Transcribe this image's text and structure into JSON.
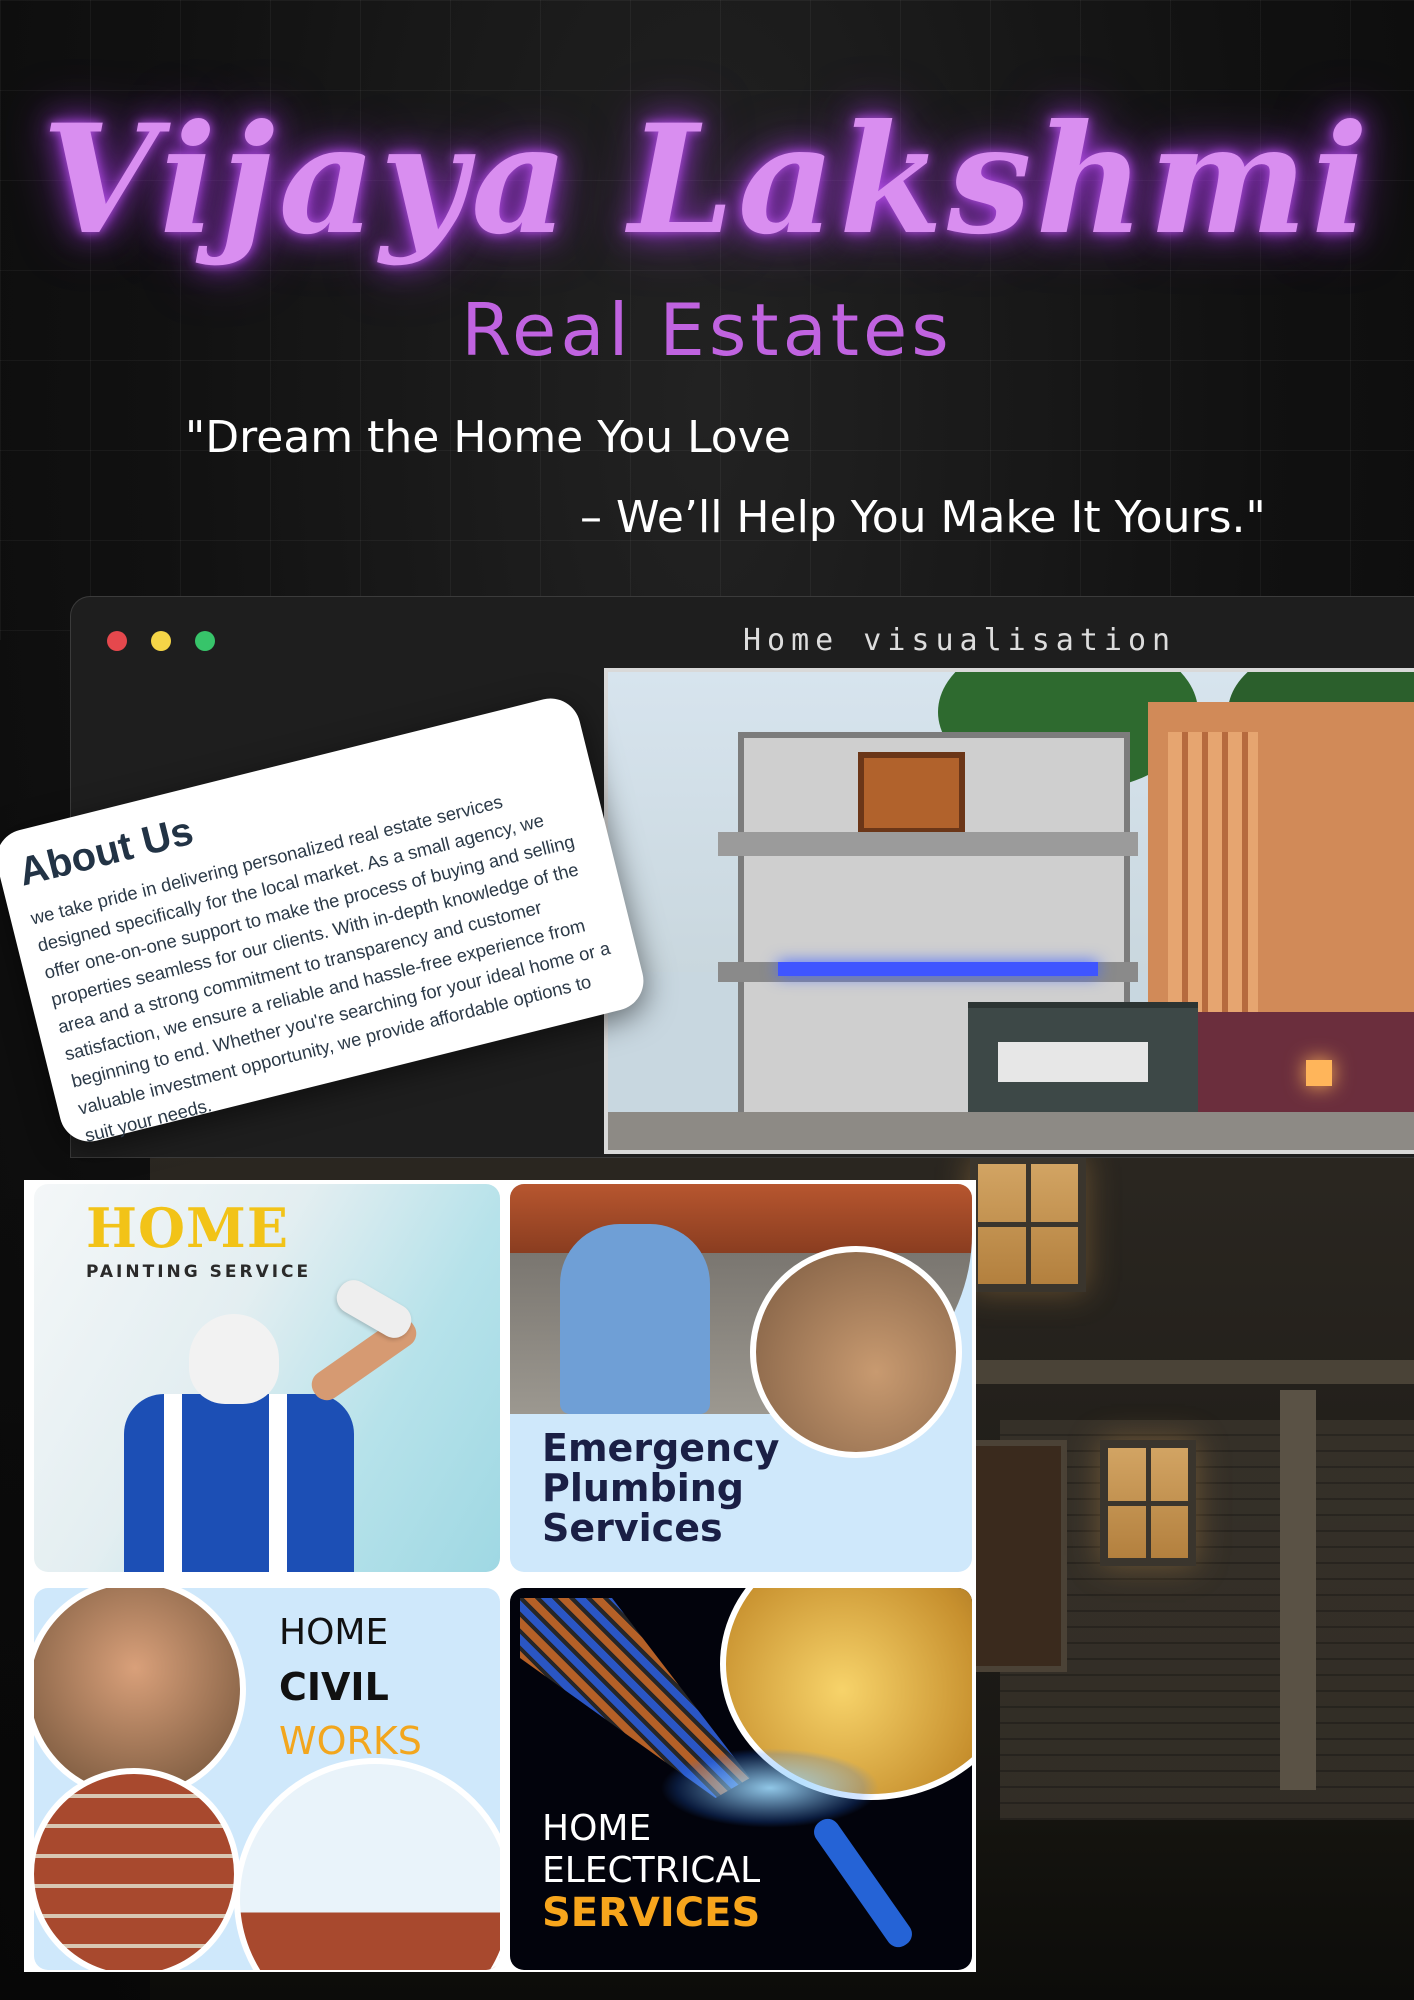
{
  "header": {
    "title": "Vijaya Lakshmi",
    "subtitle": "Real Estates",
    "tagline_line1": "\"Dream the Home You Love",
    "tagline_line2": "– We’ll Help You Make It Yours.\""
  },
  "browser": {
    "window_title": "Home visualisation"
  },
  "about": {
    "heading": "About Us",
    "body": "we take pride in delivering personalized real estate services designed specifically for the local market. As a small agency, we offer one-on-one support to make the process of buying and selling properties seamless for our clients. With in-depth knowledge of the area and a strong commitment to transparency and customer satisfaction, we ensure a reliable and hassle-free experience from beginning to end. Whether you're searching for your ideal home or a valuable investment opportunity, we provide affordable options to suit your needs."
  },
  "services": {
    "painting": {
      "title": "HOME",
      "subtitle": "PAINTING SERVICE"
    },
    "plumbing": {
      "line1": "Emergency",
      "line2": "Plumbing",
      "line3": "Services"
    },
    "civil": {
      "line1": "HOME",
      "line2": "CIVIL",
      "line3": "WORKS"
    },
    "electrical": {
      "line1": "HOME",
      "line2": "ELECTRICAL",
      "line3": "SERVICES"
    }
  },
  "colors": {
    "title_neon": "#d98ef0",
    "subtitle": "#c063e0",
    "painting_accent": "#f2c318",
    "civil_accent": "#f2a61e",
    "electrical_accent": "#f7a51c",
    "dot_red": "#e5484d",
    "dot_yellow": "#f5d547",
    "dot_green": "#37c46a"
  }
}
